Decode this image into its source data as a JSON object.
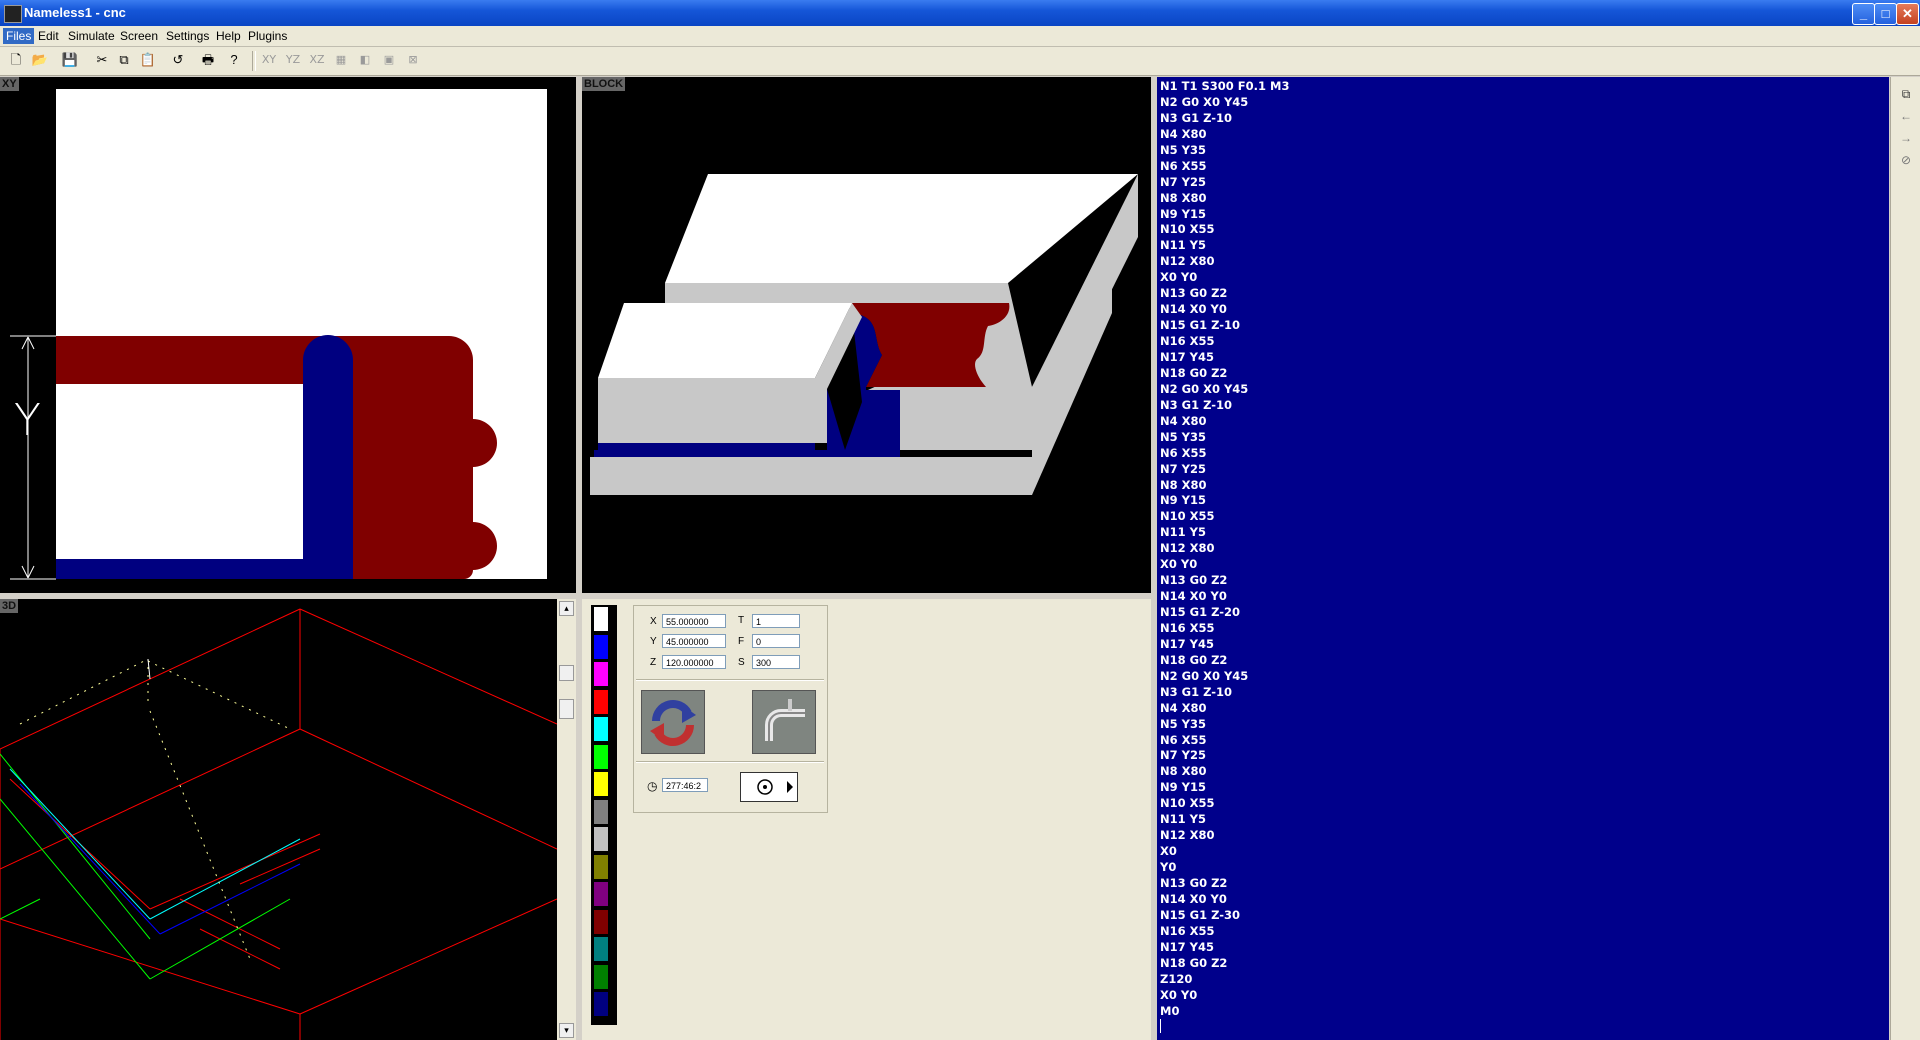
{
  "window": {
    "title": "Nameless1 - cnc",
    "buttons": [
      "_",
      "□",
      "✕"
    ]
  },
  "menu": [
    {
      "label": "Files",
      "active": true
    },
    {
      "label": "Edit"
    },
    {
      "label": "Simulate"
    },
    {
      "label": "Screen"
    },
    {
      "label": "Settings"
    },
    {
      "label": "Help"
    },
    {
      "label": "Plugins"
    }
  ],
  "toolbar": {
    "icons": [
      "new-file-icon",
      "open-folder-icon",
      "save-icon",
      "cut-icon",
      "copy-icon",
      "paste-icon",
      "undo-icon",
      "print-icon",
      "help-icon"
    ],
    "views": [
      "XY",
      "YZ",
      "XZ"
    ]
  },
  "panels": {
    "xy_label": "XY",
    "block_label": "BLOCK",
    "view3d_label": "3D",
    "xy_axis_label": "Y"
  },
  "colors": {
    "material": "#ffffff",
    "cut_red": "#800000",
    "cut_blue": "#000080",
    "code_bg": "#00008b",
    "side_gray": "#c8c8c8"
  },
  "palette": [
    "#ffffff",
    "#0000ff",
    "#ff00ff",
    "#ff0000",
    "#00ffff",
    "#00ff00",
    "#ffff00",
    "#808080",
    "#c0c0c0",
    "#808000",
    "#800080",
    "#800000",
    "#008080",
    "#008000",
    "#000080"
  ],
  "control": {
    "x_label": "X",
    "x_value": "55.000000",
    "y_label": "Y",
    "y_value": "45.000000",
    "z_label": "Z",
    "z_value": "120.000000",
    "t_label": "T",
    "t_value": "1",
    "f_label": "F",
    "f_value": "0",
    "s_label": "S",
    "s_value": "300",
    "time_value": "277:46:2"
  },
  "code_lines": [
    "N1 T1 S300 F0.1 M3",
    "N2 G0 X0 Y45",
    "N3 G1 Z-10",
    "N4 X80",
    "N5 Y35",
    "N6 X55",
    "N7 Y25",
    "N8 X80",
    "N9 Y15",
    "N10 X55",
    "N11 Y5",
    "N12 X80",
    "X0 Y0",
    "N13 G0 Z2",
    "N14 X0 Y0",
    "N15 G1 Z-10",
    "N16 X55",
    "N17 Y45",
    "N18 G0 Z2",
    "N2 G0 X0 Y45",
    "N3 G1 Z-10",
    "N4 X80",
    "N5 Y35",
    "N6 X55",
    "N7 Y25",
    "N8 X80",
    "N9 Y15",
    "N10 X55",
    "N11 Y5",
    "N12 X80",
    "X0 Y0",
    "N13 G0 Z2",
    "N14 X0 Y0",
    "N15 G1 Z-20",
    "N16 X55",
    "N17 Y45",
    "N18 G0 Z2",
    "N2 G0 X0 Y45",
    "N3 G1 Z-10",
    "N4 X80",
    "N5 Y35",
    "N6 X55",
    "N7 Y25",
    "N8 X80",
    "N9 Y15",
    "N10 X55",
    "N11 Y5",
    "N12 X80",
    "X0",
    "Y0",
    "N13 G0 Z2",
    "N14 X0 Y0",
    "N15 G1 Z-30",
    "N16 X55",
    "N17 Y45",
    "N18 G0 Z2",
    "Z120",
    "X0 Y0",
    "M0"
  ]
}
